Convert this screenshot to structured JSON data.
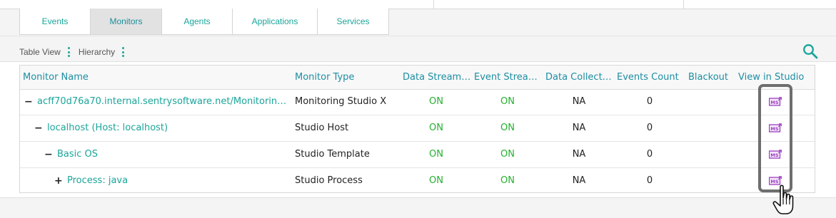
{
  "tabs": [
    "Events",
    "Monitors",
    "Agents",
    "Applications",
    "Services"
  ],
  "active_tab": "Monitors",
  "view_options": {
    "table_view": "Table View",
    "hierarchy": "Hierarchy"
  },
  "columns": [
    "Monitor Name",
    "Monitor Type",
    "Data Streaming",
    "Event Streaming",
    "Data Collection",
    "Events Count",
    "Blackout",
    "View in Studio"
  ],
  "rows": [
    {
      "toggle": "−",
      "name": "acff70d76a70.internal.sentrysoftware.net/Monitoring Studio X",
      "type": "Monitoring Studio X",
      "data_streaming": "ON",
      "event_streaming": "ON",
      "data_collection": "NA",
      "events_count": "0",
      "blackout": "",
      "level": 0
    },
    {
      "toggle": "−",
      "name": "localhost (Host: localhost)",
      "type": "Studio Host",
      "data_streaming": "ON",
      "event_streaming": "ON",
      "data_collection": "NA",
      "events_count": "0",
      "blackout": "",
      "level": 1
    },
    {
      "toggle": "−",
      "name": "Basic OS",
      "type": "Studio Template",
      "data_streaming": "ON",
      "event_streaming": "ON",
      "data_collection": "NA",
      "events_count": "0",
      "blackout": "",
      "level": 2
    },
    {
      "toggle": "+",
      "name": "Process: java",
      "type": "Studio Process",
      "data_streaming": "ON",
      "event_streaming": "ON",
      "data_collection": "NA",
      "events_count": "0",
      "blackout": "",
      "level": 3
    }
  ],
  "icons": {
    "view_menu": "kebab-icon",
    "search": "search-icon",
    "studio": "monitoring-studio-icon",
    "pointer": "hand-cursor-icon"
  },
  "colors": {
    "accent": "#1aa59a",
    "header_text": "#1d8ea3",
    "on_status": "#24b12f",
    "studio_icon": "#9c3fbf",
    "highlight_border": "#6e6e6e"
  }
}
